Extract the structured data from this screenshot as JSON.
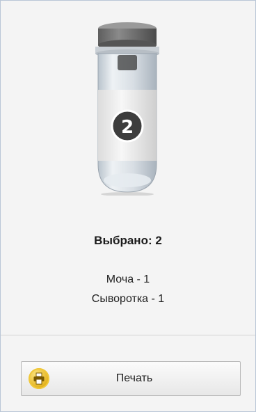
{
  "tube": {
    "badge_number": "2",
    "icon": "test-tube-icon"
  },
  "summary": {
    "selected_label": "Выбрано: 2",
    "lines": [
      "Моча - 1",
      "Сыворотка - 1"
    ]
  },
  "print_button": {
    "label": "Печать",
    "icon": "printer-icon"
  },
  "colors": {
    "accent_yellow": "#e3b21d",
    "border": "#b9c6d6"
  }
}
